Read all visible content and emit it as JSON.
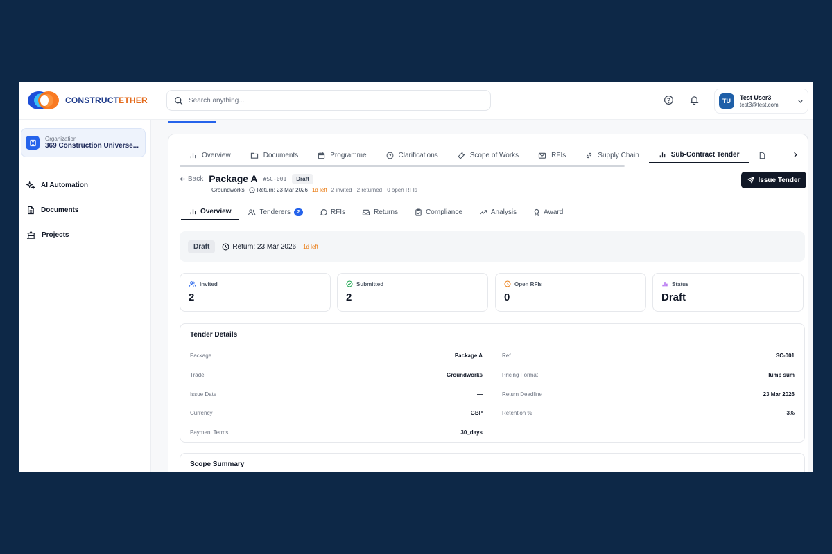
{
  "brand": {
    "name_main": "Construct",
    "name_accent": "Ether"
  },
  "search": {
    "placeholder": "Search anything..."
  },
  "user": {
    "initials": "TU",
    "name": "Test User3",
    "email": "test3@test.com"
  },
  "sidebar": {
    "org_label": "Organization",
    "org_name": "369 Construction Universe...",
    "items": [
      {
        "label": "AI Automation",
        "icon": "sparkles-icon"
      },
      {
        "label": "Documents",
        "icon": "document-icon"
      },
      {
        "label": "Projects",
        "icon": "projects-icon"
      }
    ]
  },
  "project_tabs": [
    {
      "label": "Overview",
      "icon": "bar-chart-icon"
    },
    {
      "label": "Documents",
      "icon": "folder-icon"
    },
    {
      "label": "Programme",
      "icon": "calendar-icon"
    },
    {
      "label": "Clarifications",
      "icon": "help-circle-icon"
    },
    {
      "label": "Scope of Works",
      "icon": "wrench-icon"
    },
    {
      "label": "RFIs",
      "icon": "mail-icon"
    },
    {
      "label": "Supply Chain",
      "icon": "link-icon"
    },
    {
      "label": "Sub-Contract Tender",
      "icon": "bar-chart-icon",
      "active": true
    }
  ],
  "package": {
    "back_label": "Back",
    "title": "Package A",
    "ref": "#SC-001",
    "status": "Draft",
    "trade": "Groundworks",
    "return_text": "Return: 23 Mar 2026",
    "days_left": "1d left",
    "summary": "2 invited · 2 returned · 0 open RFIs"
  },
  "issue_button": "Issue Tender",
  "sub_tabs": [
    {
      "label": "Overview",
      "active": true
    },
    {
      "label": "Tenderers",
      "badge": "2"
    },
    {
      "label": "RFIs"
    },
    {
      "label": "Returns"
    },
    {
      "label": "Compliance"
    },
    {
      "label": "Analysis"
    },
    {
      "label": "Award"
    }
  ],
  "status_strip": {
    "status": "Draft",
    "return_text": "Return: 23 Mar 2026",
    "days_left": "1d left"
  },
  "stats": [
    {
      "label": "Invited",
      "value": "2",
      "color": "#2563eb"
    },
    {
      "label": "Submitted",
      "value": "2",
      "color": "#16a34a"
    },
    {
      "label": "Open RFIs",
      "value": "0",
      "color": "#ea7a10"
    },
    {
      "label": "Status",
      "value": "Draft",
      "color": "#9333ea"
    }
  ],
  "tender_details": {
    "title": "Tender Details",
    "left": [
      {
        "k": "Package",
        "v": "Package A"
      },
      {
        "k": "Trade",
        "v": "Groundworks"
      },
      {
        "k": "Issue Date",
        "v": "—"
      },
      {
        "k": "Currency",
        "v": "GBP"
      },
      {
        "k": "Payment Terms",
        "v": "30_days"
      }
    ],
    "right": [
      {
        "k": "Ref",
        "v": "SC-001"
      },
      {
        "k": "Pricing Format",
        "v": "lump sum"
      },
      {
        "k": "Return Deadline",
        "v": "23 Mar 2026"
      },
      {
        "k": "Retention %",
        "v": "3%"
      }
    ]
  },
  "scope_summary": {
    "title": "Scope Summary"
  }
}
